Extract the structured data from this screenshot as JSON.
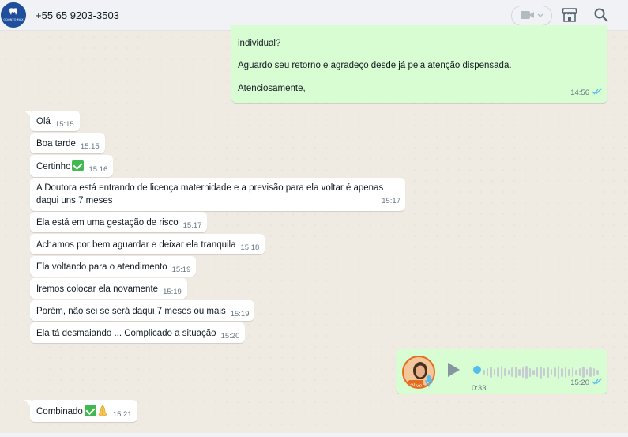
{
  "header": {
    "contact_name": "+55 65 9203-3503",
    "avatar_text": "ODONTO MAX"
  },
  "colors": {
    "incoming_bubble": "#ffffff",
    "outgoing_bubble": "#d9fdd3",
    "chat_background": "#efeae2",
    "read_ticks": "#53bdeb"
  },
  "outgoing_text": {
    "line1": "individual?",
    "line2": "Aguardo seu retorno e agradeço desde já pela atenção dispensada.",
    "line3": "Atenciosamente,",
    "time": "14:56"
  },
  "messages": [
    {
      "text": "Olá",
      "time": "15:15"
    },
    {
      "text": "Boa tarde",
      "time": "15:15"
    },
    {
      "text": "Certinho",
      "time": "15:16"
    },
    {
      "text": "A Doutora está entrando de licença maternidade e a previsão para ela voltar é apenas daqui uns 7 meses",
      "time": "15:17"
    },
    {
      "text": "Ela está em uma gestação de risco",
      "time": "15:17"
    },
    {
      "text": "Achamos por bem aguardar e deixar ela tranquila",
      "time": "15:18"
    },
    {
      "text": "Ela voltando para o atendimento",
      "time": "15:19"
    },
    {
      "text": "Iremos colocar ela novamente",
      "time": "15:19"
    },
    {
      "text": "Porém, não sei se será daqui 7 meses ou mais",
      "time": "15:19"
    },
    {
      "text": "Ela tá desmaiando ... Complicado a situação",
      "time": "15:20"
    }
  ],
  "voice_note": {
    "duration": "0:33",
    "time": "15:20",
    "avatar_label": "Olive"
  },
  "last_message": {
    "text": "Combinado",
    "time": "15:21"
  }
}
